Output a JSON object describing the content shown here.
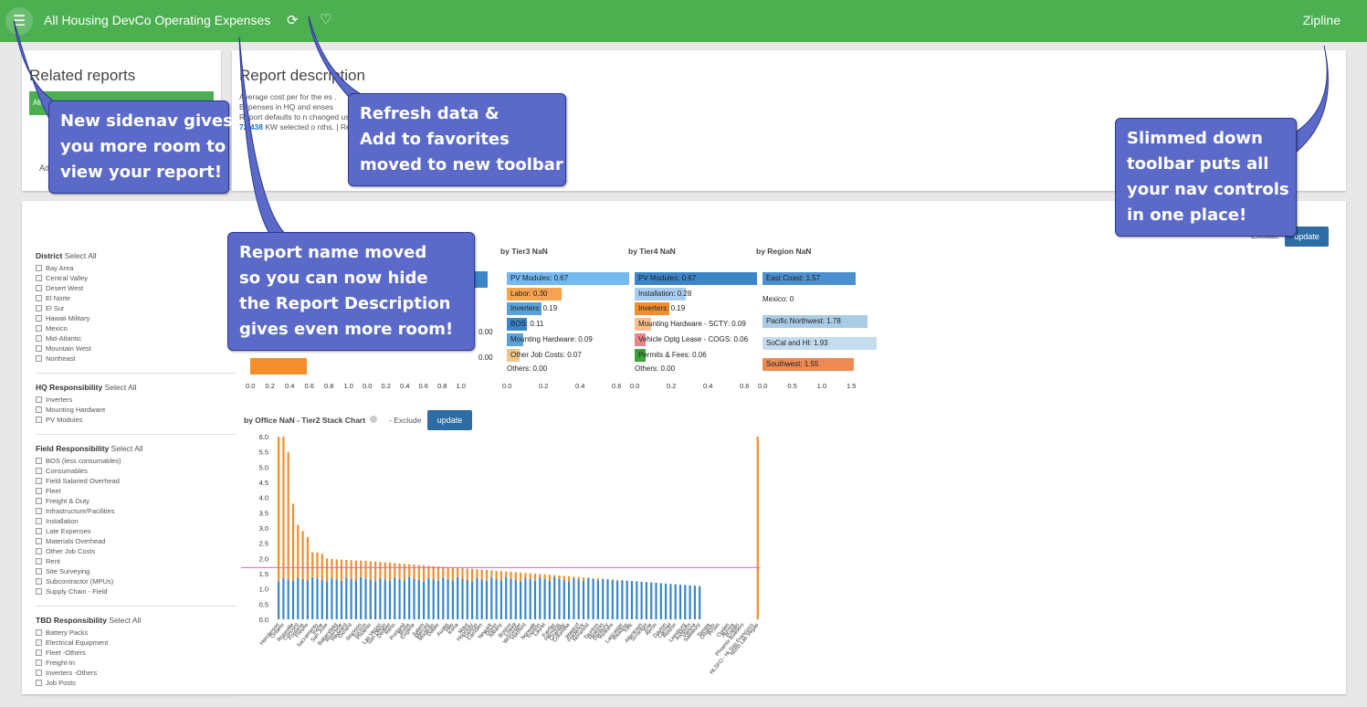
{
  "topbar": {
    "title": "All Housing DevCo Operating Expenses",
    "brand": "Zipline",
    "menu_icon": "☰",
    "refresh_icon": "⟳",
    "fav_icon": "♡"
  },
  "related": {
    "title": "Related reports",
    "item": "All",
    "footer": "Ad"
  },
  "description": {
    "title": "Report description",
    "line1": "Average cost per      for the                                                                            es     .",
    "line2": "Expenses in HQ and     enses",
    "line3": "Report defaults to n                                                                                       changed using the \"Cost per Watt Trend\" chart.",
    "kw_value": "72,438",
    "line4": " KW selected o                                                                 nths. | Reset All"
  },
  "filters": {
    "select_all": "Select All",
    "groups": [
      {
        "title": "District",
        "items": [
          "Bay Area",
          "Central Valley",
          "Desert West",
          "El Norte",
          "El Sur",
          "Hawaii Military",
          "Mexico",
          "Mid-Atlantic",
          "Mountain West",
          "Northeast"
        ]
      },
      {
        "title": "HQ Responsibility",
        "items": [
          "Inverters",
          "Mounting Hardware",
          "PV Modules"
        ]
      },
      {
        "title": "Field Responsibility",
        "items": [
          "BOS (less consumables)",
          "Consumables",
          "Field Salaried Overhead",
          "Fleet",
          "Freight & Duty",
          "Infrastructure/Facilities",
          "Installation",
          "Late Expenses",
          "Materials Overhead",
          "Other Job Costs",
          "Rent",
          "Site Surveying",
          "Subcontractor (MPUs)",
          "Supply Chain - Field"
        ]
      },
      {
        "title": "TBD Responsibility",
        "items": [
          "Battery Packs",
          "Electrical Equipment",
          "Fleet -Others",
          "Freight-In",
          "Inverters -Others",
          "Job Posts"
        ]
      }
    ]
  },
  "charts": {
    "tier3": {
      "title": "by Tier3 NaN",
      "rows": [
        "PV Modules: 0.67",
        "Labor: 0.30",
        "Inverters: 0.19",
        "BOS: 0.11",
        "Mounting Hardware: 0.09",
        "Other Job Costs: 0.07",
        "Others: 0.00"
      ],
      "ticks": [
        "0.0",
        "0.2",
        "0.4",
        "0.6"
      ]
    },
    "tier4": {
      "title": "by Tier4 NaN",
      "rows": [
        "PV Modules: 0.67",
        "Installation: 0.28",
        "Inverters: 0.19",
        "Mounting Hardware - SCTY: 0.09",
        "Vehicle Optg Lease - COGS: 0.06",
        "Permits & Fees: 0.06",
        "Others: 0.00"
      ],
      "ticks": [
        "0.0",
        "0.2",
        "0.4",
        "0.6"
      ]
    },
    "region": {
      "title": "by Region NaN",
      "rows": [
        "East Coast: 1.57",
        "Mexico: 0",
        "Pacific Northwest: 1.78",
        "SoCal and HI: 1.93",
        "Southwest: 1.55"
      ],
      "ticks": [
        "0.0",
        "0.5",
        "1.0",
        "1.5"
      ]
    },
    "hidden_left": {
      "ticks_a": [
        "0.0",
        "0.2",
        "0.4",
        "0.6",
        "0.8",
        "1.0"
      ],
      "ticks_b": [
        "0.0",
        "0.2",
        "0.4",
        "0.6",
        "0.8",
        "1.0"
      ],
      "values": [
        "0.00",
        "0.00"
      ]
    },
    "office": {
      "title": "by Office NaN - Tier2 Stack Chart",
      "exclude": "- Exclude",
      "yticks": [
        "6.0",
        "5.5",
        "5.0",
        "4.5",
        "4.0",
        "3.5",
        "3.0",
        "2.5",
        "2.0",
        "1.5",
        "1.0",
        "0.5",
        "0.0"
      ],
      "xlabels": [
        "Henderson",
        "Ontario",
        "Roseville",
        "Concord",
        "Fontana",
        "Fresno",
        "Sacramento",
        "Irvine",
        "San Jose",
        "Bakersfield",
        "Riverside",
        "Hayward",
        "Oxnard",
        "Stockton",
        "Tucson",
        "Phoenix",
        "Las Vegas",
        "San Diego",
        "Denver",
        "Reno",
        "Portland",
        "Boise",
        "Eugene",
        "Salem",
        "Merced",
        "Modesto",
        "Dallas",
        "Austin",
        "Hilo",
        "Kona",
        "Maui",
        "Honolulu",
        "Trenton",
        "Camden",
        "Newark",
        "Dover",
        "Albany",
        "Boston",
        "Lowell",
        "Worcester",
        "Hartford",
        "Norwalk",
        "Towson",
        "Laurel",
        "Fairfax",
        "Herndon",
        "Chantilly",
        "Columbia",
        "Waldorf",
        "Frederick",
        "Norwood",
        "Taunton",
        "Hyannis",
        "Danbury",
        "Yonkers",
        "Lancaster",
        "Reading",
        "York",
        "Allentown",
        "Scranton",
        "Erie",
        "Akron",
        "Dayton",
        "Carmel",
        "Reston",
        "Leesburg",
        "Ashburn",
        "Vienna",
        "Salisbury",
        "Tampa",
        "Orlando",
        "Provo",
        "Ogden",
        "Aurora",
        "Pueblo",
        "Phoenix Builders",
        "HLSFO - Hi San Francisco",
        "North Las Vegas"
      ]
    }
  },
  "buttons": {
    "update": "update",
    "exclude_top": "Exclude"
  },
  "callouts": {
    "sidenav": [
      "New sidenav gives",
      "you more room to",
      "view your report!"
    ],
    "refresh": [
      "Refresh data &",
      "Add to favorites",
      "moved to new toolbar"
    ],
    "toolbar": [
      "Slimmed down",
      "toolbar puts all",
      "your nav controls",
      "in one place!"
    ],
    "report_name": [
      "Report name moved",
      "so you can now hide",
      "the Report Description",
      "gives even more room!"
    ]
  },
  "colors": {
    "green": "#4caf50",
    "callout": "#5b6ac9",
    "blue": "#3a86c8",
    "orange": "#f28e2b",
    "target_line": "#e060e0"
  }
}
